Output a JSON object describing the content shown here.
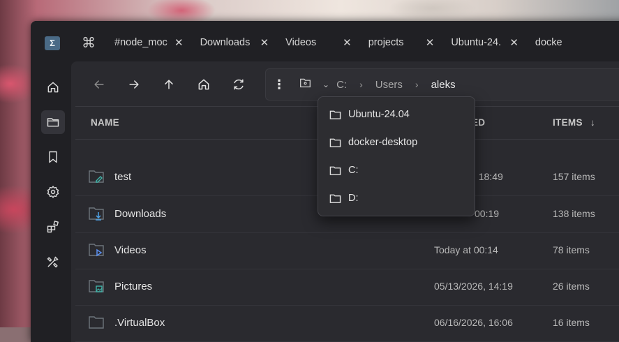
{
  "app": {
    "logo_glyph": "Σ"
  },
  "tabs": [
    {
      "label": "#node_moc",
      "width": 0
    },
    {
      "label": "Downloads"
    },
    {
      "label": "Videos"
    },
    {
      "label": "projects"
    },
    {
      "label": "Ubuntu-24."
    },
    {
      "label": "docke"
    }
  ],
  "tab_close_glyph": "✕",
  "tab_cmd_glyph": "⌘",
  "rail": {
    "items": [
      {
        "name": "home",
        "icon": "home-icon"
      },
      {
        "name": "files",
        "icon": "folder-icon",
        "active": true
      },
      {
        "name": "bookmarks",
        "icon": "bookmark-icon"
      },
      {
        "name": "settings",
        "icon": "gear-icon"
      },
      {
        "name": "extensions",
        "icon": "apps-icon"
      },
      {
        "name": "tools",
        "icon": "tools-icon"
      }
    ]
  },
  "toolbar": {
    "back": "back-arrow-icon",
    "forward": "forward-arrow-icon",
    "up": "up-arrow-icon",
    "home": "home-icon",
    "refresh": "refresh-icon"
  },
  "address": {
    "more_glyph": "⋮",
    "chevron_glyph": "⌄",
    "crumbs": [
      "C:",
      "Users",
      "aleks"
    ],
    "separator": "›"
  },
  "columns": {
    "name": "NAME",
    "modified": "ED",
    "items": "ITEMS",
    "sort_glyph": "↓"
  },
  "files": [
    {
      "name": "test",
      "modified": "y, 18:49",
      "items": "157 items",
      "icon": "folder-edit-icon"
    },
    {
      "name": "Downloads",
      "modified": "00:19",
      "items": "138 items",
      "icon": "folder-download-icon"
    },
    {
      "name": "Videos",
      "modified": "Today at 00:14",
      "items": "78 items",
      "icon": "folder-video-icon"
    },
    {
      "name": "Pictures",
      "modified": "05/13/2026, 14:19",
      "items": "26 items",
      "icon": "folder-image-icon"
    },
    {
      "name": ".VirtualBox",
      "modified": "06/16/2026, 16:06",
      "items": "16 items",
      "icon": "folder-icon"
    }
  ],
  "flyout": {
    "items": [
      "Ubuntu-24.04",
      "docker-desktop",
      "C:",
      "D:"
    ]
  },
  "colors": {
    "accent_blue": "#3b8fd9",
    "download_blue": "#4ea3e8",
    "video_blue": "#5b8ff0",
    "image_teal": "#3fb3a8"
  }
}
